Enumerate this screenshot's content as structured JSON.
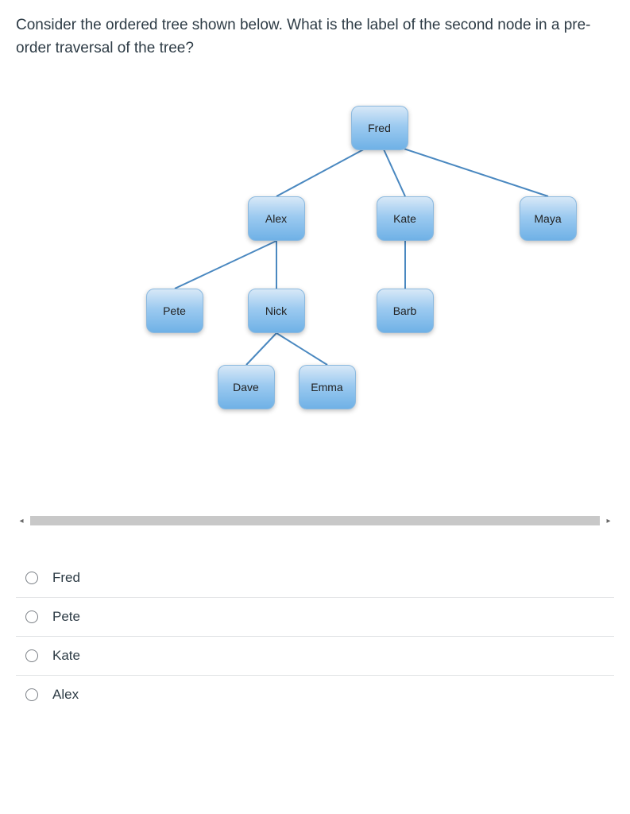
{
  "question": "Consider the ordered tree shown below. What is the label of the second node in a pre-order traversal of the tree?",
  "tree": {
    "fred": "Fred",
    "alex": "Alex",
    "kate": "Kate",
    "maya": "Maya",
    "pete": "Pete",
    "nick": "Nick",
    "barb": "Barb",
    "dave": "Dave",
    "emma": "Emma"
  },
  "scroll": {
    "left_glyph": "◂",
    "right_glyph": "▸"
  },
  "options": [
    {
      "label": "Fred"
    },
    {
      "label": "Pete"
    },
    {
      "label": "Kate"
    },
    {
      "label": "Alex"
    }
  ]
}
